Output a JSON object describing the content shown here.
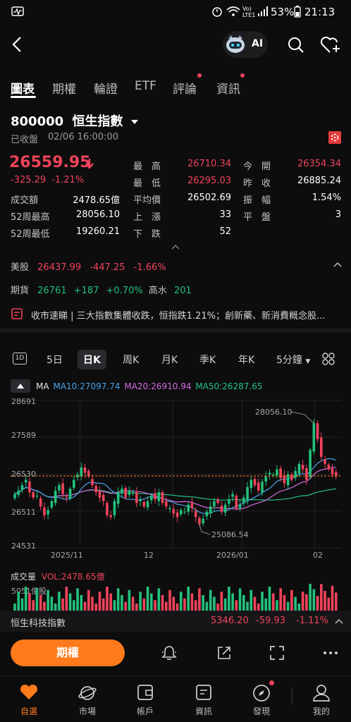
{
  "status": {
    "battery": "53%",
    "time": "21:13"
  },
  "header": {
    "ai_label": "AI"
  },
  "tabs": [
    {
      "label": "圖表"
    },
    {
      "label": "期權"
    },
    {
      "label": "輪證"
    },
    {
      "label": "ETF"
    },
    {
      "label": "評論"
    },
    {
      "label": "資訊"
    }
  ],
  "quote": {
    "code": "800000",
    "name": "恒生指數",
    "status": "已收盤",
    "datetime": "02/06 16:00:00",
    "price": "26559.95",
    "change": "-325.29",
    "change_pct": "-1.21%",
    "stats": {
      "high_label": "最　高",
      "high": "26710.34",
      "low_label": "最　低",
      "low": "26295.03",
      "avg_label": "平均價",
      "avg": "26502.69",
      "up_label": "上　漲",
      "up": "33",
      "down_label": "下　跌",
      "down": "52",
      "open_label": "今　開",
      "open": "26354.34",
      "prev_label": "昨　收",
      "prev": "26885.24",
      "amp_label": "振　幅",
      "amp": "1.54%",
      "flat_label": "平　盤",
      "flat": "3",
      "turnover_label": "成交額",
      "turnover": "2478.65億",
      "w52h_label": "52周最高",
      "w52h": "28056.10",
      "w52l_label": "52周最低",
      "w52l": "19260.21"
    }
  },
  "us": {
    "label": "美股",
    "price": "26437.99",
    "change": "-447.25",
    "pct": "-1.66%"
  },
  "futures": {
    "label": "期貨",
    "price": "26761",
    "change": "+187",
    "pct": "+0.70%",
    "premium_label": "高水",
    "premium": "201"
  },
  "news": {
    "text": "收市速睇 | 三大指數集體收跌，恒指跌1.21%；創新藥、新消費概念股..."
  },
  "periods": [
    "1D",
    "5日",
    "日K",
    "周K",
    "月K",
    "季K",
    "年K",
    "5分鐘"
  ],
  "ma": {
    "label": "MA",
    "ma10": "MA10:27097.74",
    "ma20": "MA20:26910.94",
    "ma50": "MA50:26287.65"
  },
  "chart_data": {
    "type": "candlestick",
    "y_ticks": [
      "28691",
      "27589",
      "26530",
      "26511",
      "24531"
    ],
    "x_ticks": [
      "2025/11",
      "12",
      "2026/01",
      "02"
    ],
    "ylim": [
      24531,
      28691
    ],
    "annotations": {
      "high": "28056.10",
      "low": "25086.54"
    },
    "last_close": 26559.95,
    "closes": [
      26050,
      26150,
      26300,
      26450,
      26100,
      25950,
      26000,
      25700,
      25450,
      25600,
      25850,
      26150,
      26300,
      26050,
      25950,
      26200,
      26450,
      26600,
      26800,
      26650,
      26550,
      26300,
      26100,
      25950,
      25850,
      25450,
      25400,
      25850,
      26100,
      26200,
      25950,
      26150,
      26100,
      25800,
      25900,
      25700,
      25850,
      26000,
      25900,
      26100,
      25800,
      25700,
      25650,
      25500,
      25400,
      25600,
      25550,
      25750,
      25650,
      25400,
      25200,
      25350,
      25550,
      25700,
      25850,
      25800,
      25550,
      25750,
      25900,
      26050,
      25650,
      25750,
      25950,
      26250,
      26450,
      26300,
      26150,
      26400,
      26550,
      26650,
      26600,
      26750,
      26500,
      26350,
      26600,
      26450,
      26700,
      26900,
      26750,
      26450,
      27300,
      28050,
      27600,
      27100,
      26900,
      26750,
      26600,
      26560
    ],
    "volume_label": "成交量",
    "volume_value": "VOL:2478.65億",
    "volume_max": "5051億股"
  },
  "hstech": {
    "label": "恒生科技指數",
    "price": "5346.20",
    "change": "-59.93",
    "pct": "-1.11%"
  },
  "actions": {
    "options_button": "期權"
  },
  "nav": [
    "自選",
    "市場",
    "帳戶",
    "資訊",
    "發現",
    "我的"
  ],
  "colors": {
    "up": "#22c17a",
    "down": "#f0435a",
    "accent": "#ff7a1a",
    "ma10": "#4aa3e8",
    "ma20": "#d66be0",
    "ma50": "#21c48a"
  }
}
